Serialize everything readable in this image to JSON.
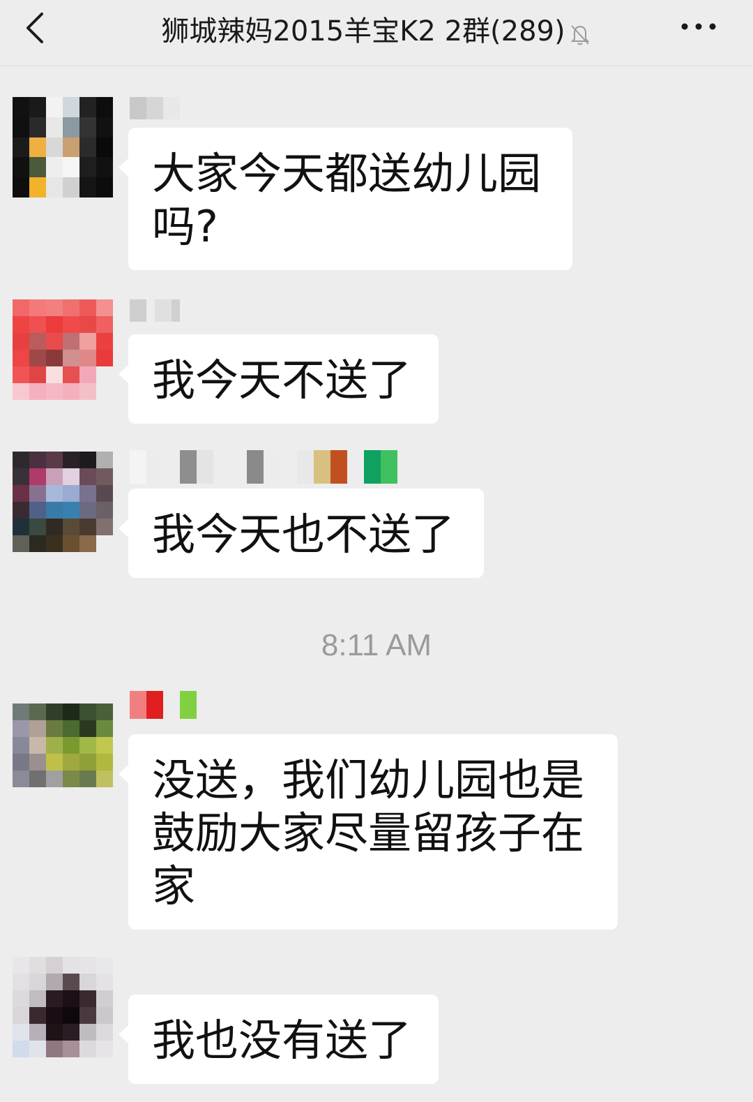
{
  "header": {
    "title": "狮城辣妈2015羊宝K2 2群(289)",
    "back_icon": "chevron-left-icon",
    "muted_icon": "bell-off-icon",
    "more_icon": "more-dots-icon"
  },
  "messages": [
    {
      "sender_redacted": true,
      "text": "大家今天都送幼儿园吗?"
    },
    {
      "sender_redacted": true,
      "text": "我今天不送了"
    },
    {
      "sender_redacted": true,
      "text": "我今天也不送了"
    },
    {
      "timestamp": "8:11 AM"
    },
    {
      "sender_redacted": true,
      "text": "没送，我们幼儿园也是鼓励大家尽量留孩子在家"
    },
    {
      "sender_redacted": true,
      "text": "我也没有送了"
    }
  ],
  "colors": {
    "background": "#ededed",
    "bubble": "#ffffff",
    "text": "#111111",
    "timestamp": "#9a9a9a"
  }
}
